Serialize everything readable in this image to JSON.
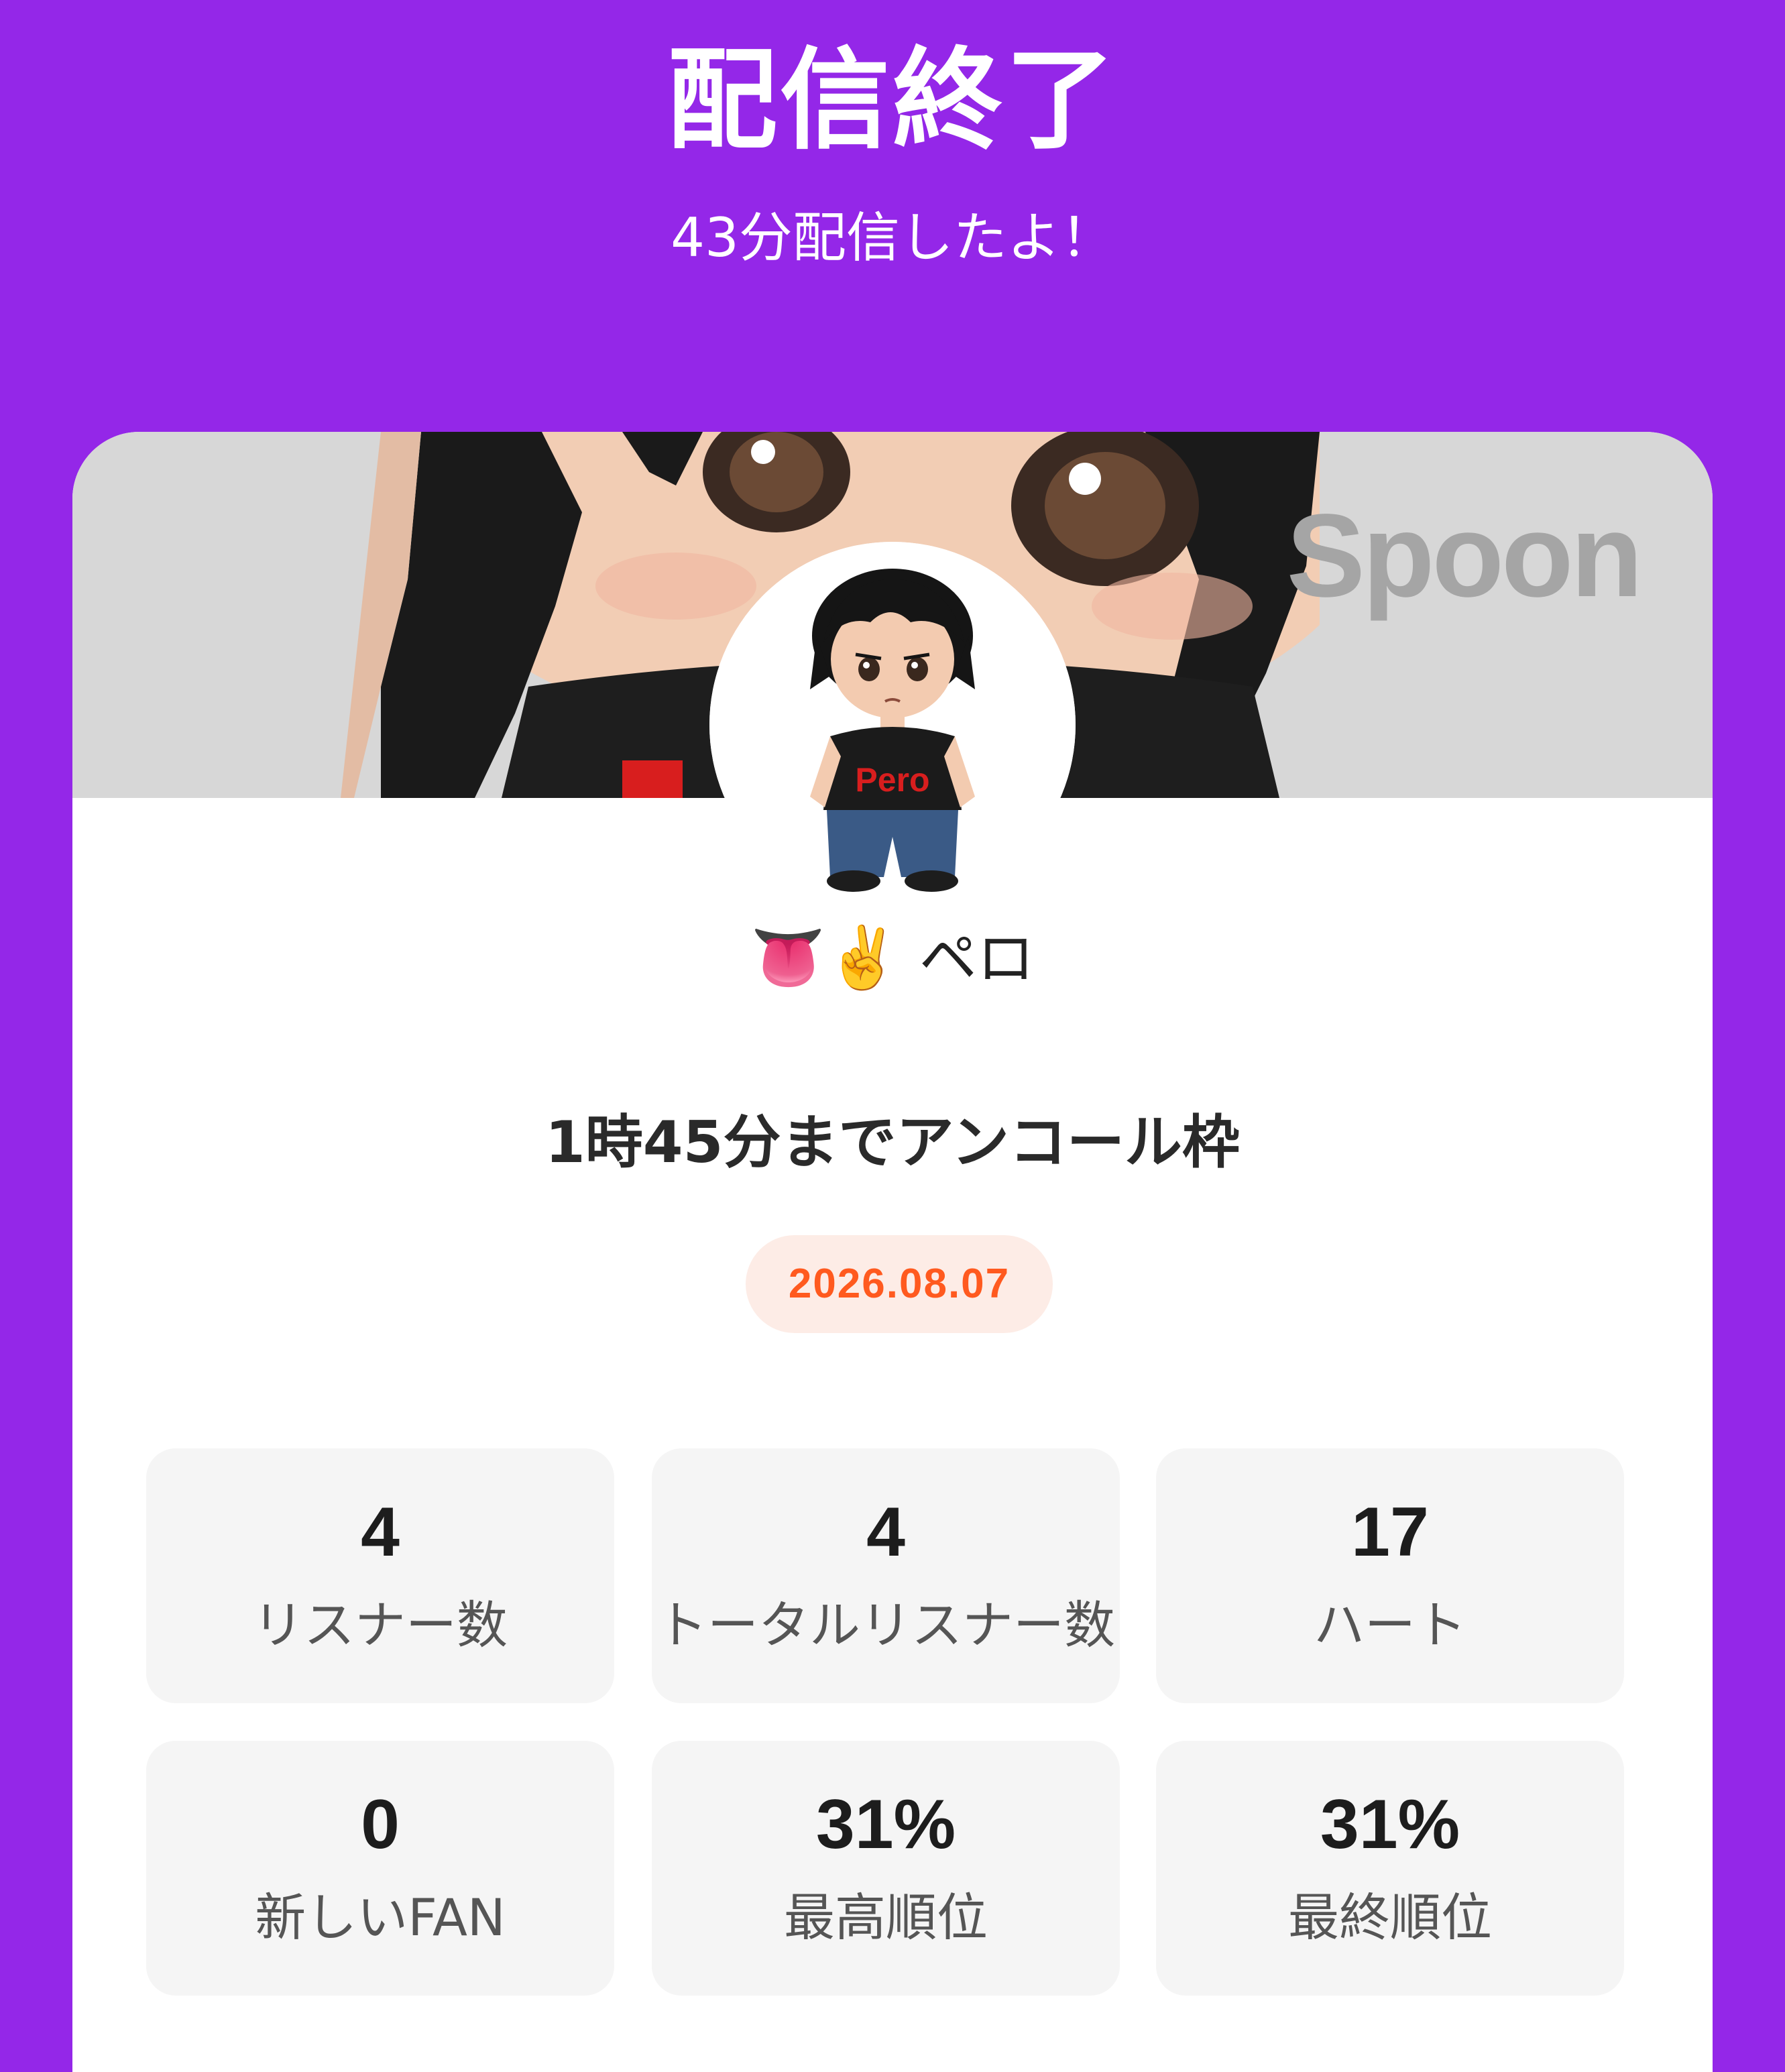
{
  "header": {
    "title": "配信終了",
    "subtitle": "43分配信したよ！"
  },
  "card": {
    "cover_logo": "Spoon",
    "nickname": {
      "emojis": "👅✌️",
      "name": "ペロ"
    },
    "avatar_shirt_text": "Pero",
    "live_title": "1時45分までアンコール枠",
    "date": "2026.08.07",
    "colors": {
      "brand": "#9427e8",
      "date_text": "#ff5a1f",
      "date_bg": "#fdece6"
    },
    "stats": [
      {
        "value": "4",
        "label": "リスナー数"
      },
      {
        "value": "4",
        "label": "トータルリスナー数"
      },
      {
        "value": "17",
        "label": "ハート"
      },
      {
        "value": "0",
        "label": "新しいFAN"
      },
      {
        "value": "31%",
        "label": "最高順位"
      },
      {
        "value": "31%",
        "label": "最終順位"
      }
    ]
  }
}
